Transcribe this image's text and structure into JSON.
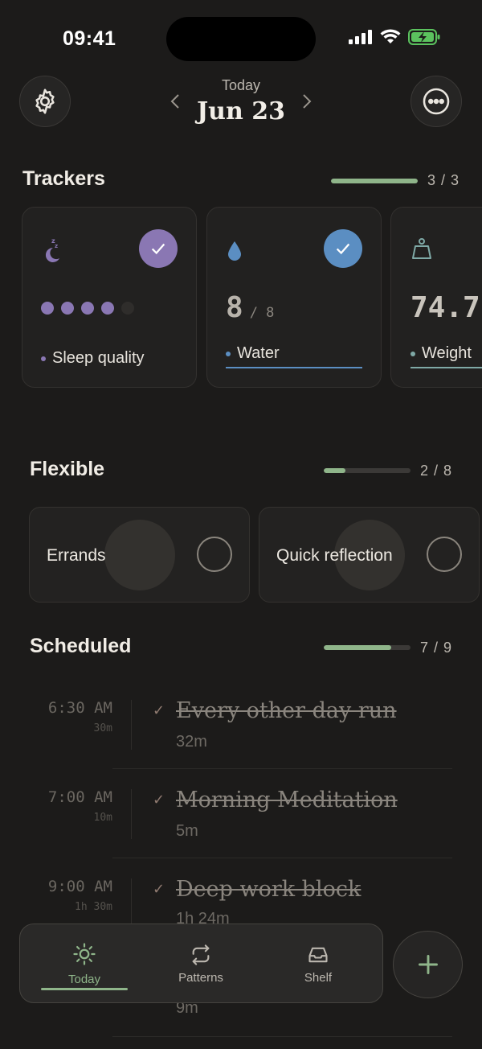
{
  "status_bar": {
    "time": "09:41"
  },
  "header": {
    "day_label": "Today",
    "date": "Jun 23"
  },
  "trackers": {
    "title": "Trackers",
    "count": "3 / 3",
    "progress": 1.0,
    "cards": [
      {
        "label": "Sleep quality",
        "icon": "moon-sleep-icon",
        "accent": "#8a77b3",
        "rating": 4,
        "rating_max": 5,
        "checked": true
      },
      {
        "label": "Water",
        "icon": "water-drop-icon",
        "accent": "#5b8ec2",
        "value": "8",
        "target": "/ 8",
        "checked": true
      },
      {
        "label": "Weight",
        "icon": "weight-icon",
        "accent": "#7fa9a6",
        "value": "74.7"
      }
    ]
  },
  "flexible": {
    "title": "Flexible",
    "count": "2 / 8",
    "progress": 0.25,
    "items": [
      {
        "label": "Errands"
      },
      {
        "label": "Quick reflection"
      }
    ]
  },
  "scheduled": {
    "title": "Scheduled",
    "count": "7 / 9",
    "progress": 0.78,
    "items": [
      {
        "time": "6:30 AM",
        "planned": "30m",
        "title": "Every other day run",
        "actual": "32m",
        "check": "✓"
      },
      {
        "time": "7:00 AM",
        "planned": "10m",
        "title": "Morning Meditation",
        "actual": "5m",
        "check": "✓"
      },
      {
        "time": "9:00 AM",
        "planned": "1h 30m",
        "title": "Deep work block",
        "actual": "1h 24m",
        "check": "✓"
      },
      {
        "actual": "9m"
      }
    ]
  },
  "tabbar": {
    "tabs": [
      {
        "label": "Today",
        "icon": "sun-icon",
        "active": true
      },
      {
        "label": "Patterns",
        "icon": "repeat-icon",
        "active": false
      },
      {
        "label": "Shelf",
        "icon": "inbox-tray-icon",
        "active": false
      }
    ]
  },
  "colors": {
    "background": "#1c1b1a",
    "accent_green": "#8fb58a",
    "sleep_purple": "#8a77b3",
    "water_blue": "#5b8ec2"
  }
}
